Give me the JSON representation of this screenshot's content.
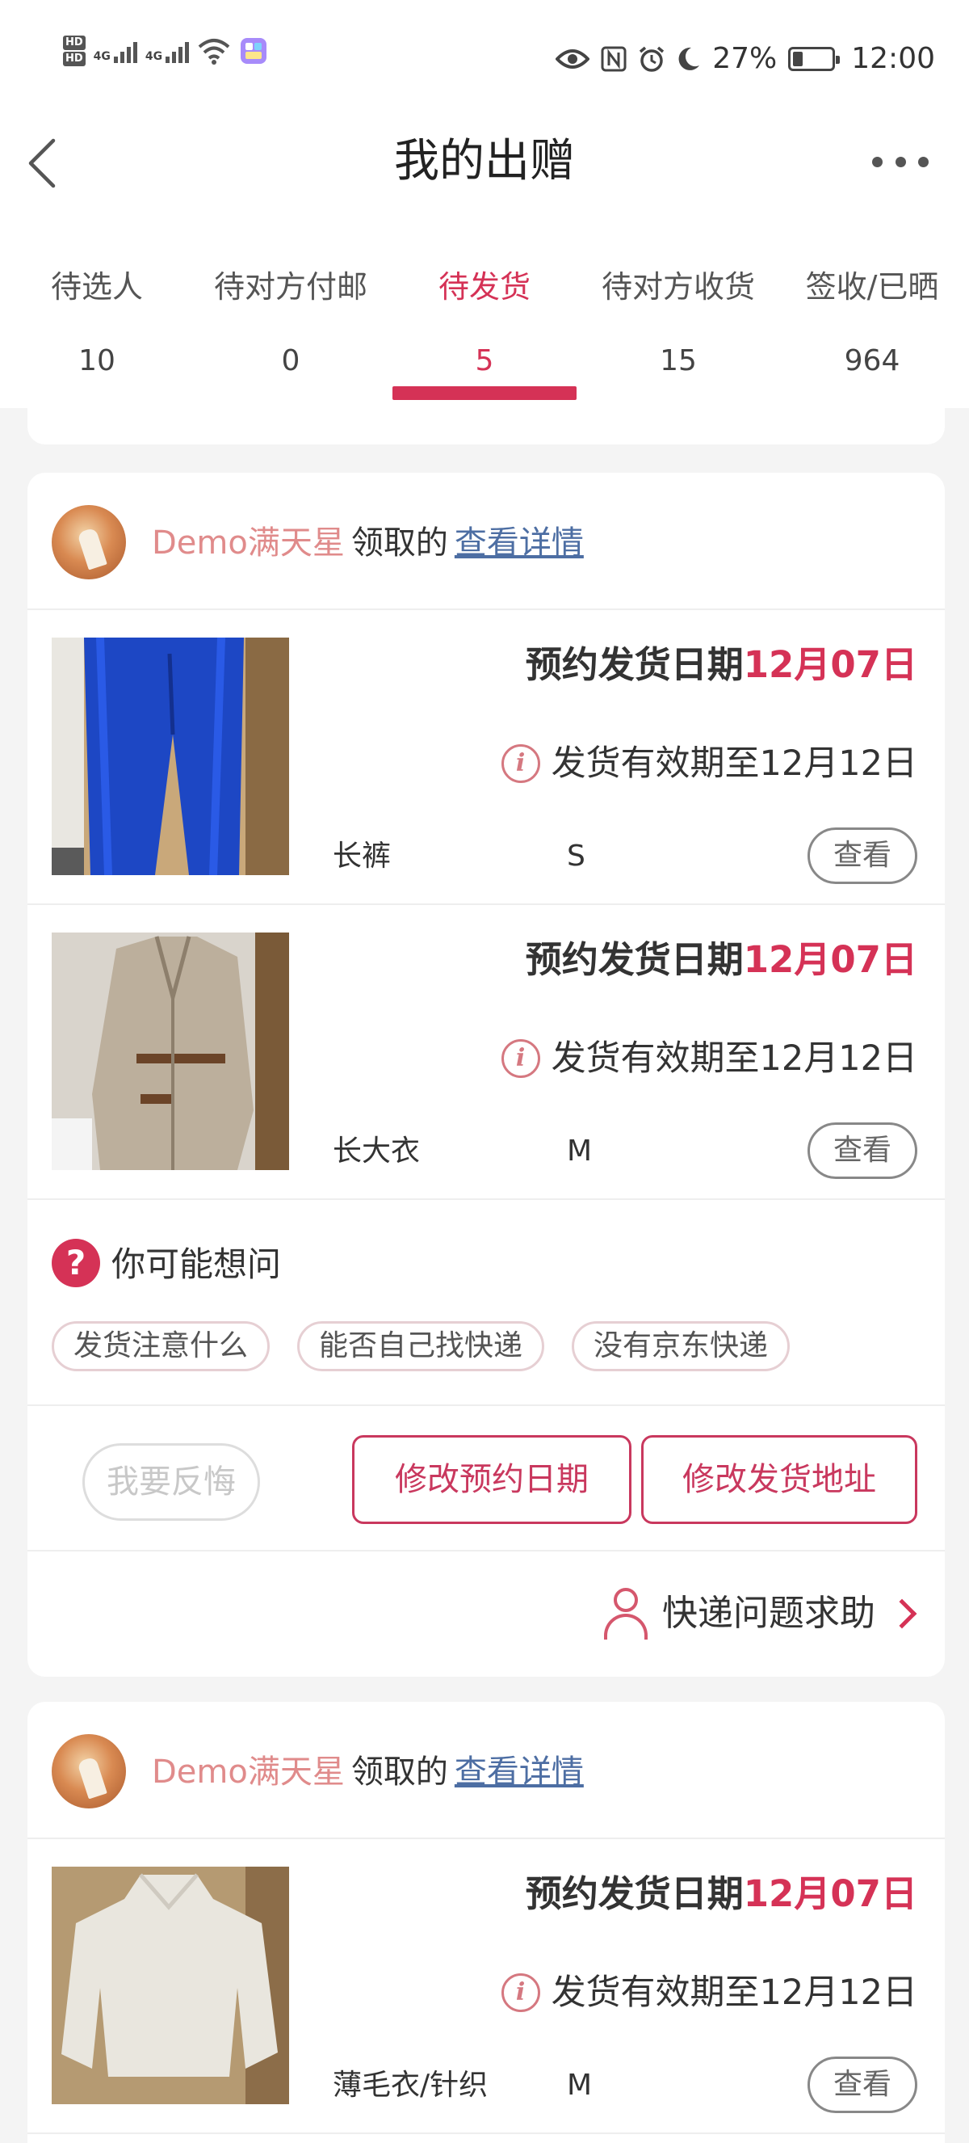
{
  "status_bar": {
    "hd1": "HD",
    "hd2": "HD",
    "net1": "4G",
    "net2": "4G",
    "battery_pct": "27%",
    "battery_fraction": 0.27,
    "time": "12:00",
    "icons": [
      "eye-icon",
      "nfc-icon",
      "alarm-icon",
      "moon-icon",
      "battery-icon",
      "wifi-icon"
    ]
  },
  "header": {
    "title": "我的出赠"
  },
  "tabs": [
    {
      "label": "待选人",
      "count": "10"
    },
    {
      "label": "待对方付邮",
      "count": "0"
    },
    {
      "label": "待发货",
      "count": "5",
      "active": true
    },
    {
      "label": "待对方收货",
      "count": "15"
    },
    {
      "label": "签收/已晒",
      "count": "964"
    }
  ],
  "orders": [
    {
      "user": "Demo满天星",
      "claim_text": "领取的",
      "detail_link": "查看详情",
      "items": [
        {
          "appoint_label": "预约发货日期",
          "appoint_date": "12月07日",
          "valid_text": "发货有效期至12月12日",
          "name": "长裤",
          "size": "S",
          "view": "查看"
        },
        {
          "appoint_label": "预约发货日期",
          "appoint_date": "12月07日",
          "valid_text": "发货有效期至12月12日",
          "name": "长大衣",
          "size": "M",
          "view": "查看"
        }
      ],
      "faq": {
        "title": "你可能想问",
        "chips": [
          "发货注意什么",
          "能否自己找快递",
          "没有京东快递"
        ]
      },
      "actions": {
        "regret": "我要反悔",
        "change_date": "修改预约日期",
        "change_address": "修改发货地址"
      },
      "help": "快递问题求助"
    },
    {
      "user": "Demo满天星",
      "claim_text": "领取的",
      "detail_link": "查看详情",
      "items": [
        {
          "appoint_label": "预约发货日期",
          "appoint_date": "12月07日",
          "valid_text": "发货有效期至12月12日",
          "name": "薄毛衣/针织",
          "size": "M",
          "view": "查看"
        }
      ]
    }
  ],
  "colors": {
    "accent": "#d53256",
    "link": "#4d6ea3",
    "username": "#e08b8b",
    "background": "#f4f4f4"
  }
}
